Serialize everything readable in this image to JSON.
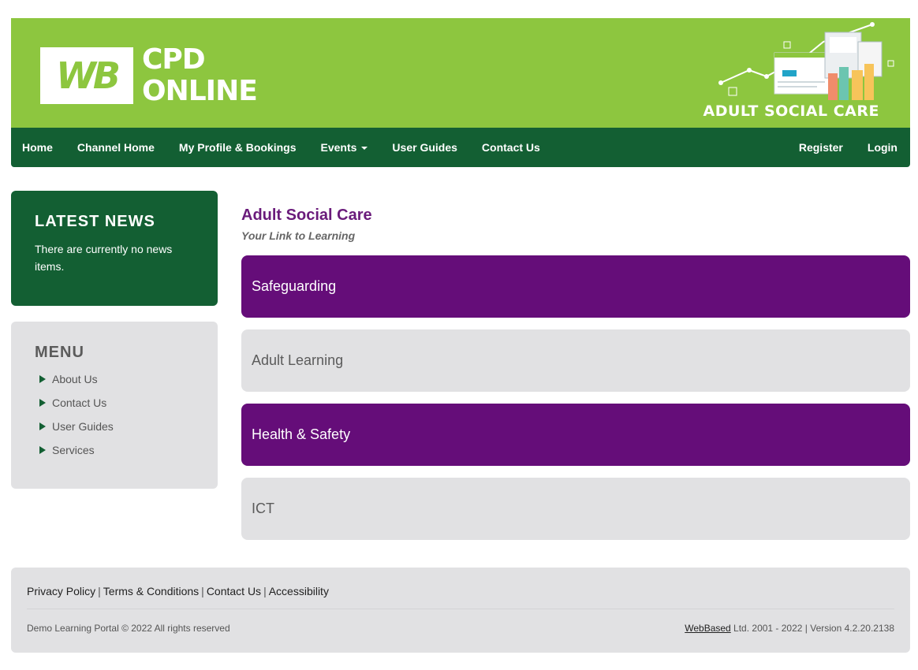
{
  "brand": {
    "logo_mark": "WB",
    "logo_line1": "CPD",
    "logo_line2": "ONLINE",
    "channel_caption": "ADULT SOCIAL CARE",
    "colors": {
      "green": "#8dc63f",
      "dark_green": "#135f33",
      "purple": "#650d79",
      "grey_panel": "#e1e1e3"
    }
  },
  "nav": {
    "left": [
      "Home",
      "Channel Home",
      "My Profile & Bookings",
      "Events",
      "User Guides",
      "Contact Us"
    ],
    "right": [
      "Register",
      "Login"
    ]
  },
  "news": {
    "title": "LATEST NEWS",
    "body": "There are currently no news items."
  },
  "menu": {
    "title": "MENU",
    "items": [
      "About Us",
      "Contact Us",
      "User Guides",
      "Services"
    ]
  },
  "main": {
    "title": "Adult Social Care",
    "subtitle": "Your Link to Learning",
    "channels": [
      "Safeguarding",
      "Adult Learning",
      "Health & Safety",
      "ICT"
    ]
  },
  "footer": {
    "links": [
      "Privacy Policy",
      "Terms & Conditions",
      "Contact Us",
      "Accessibility"
    ],
    "copyright": "Demo Learning Portal © 2022 All rights reserved",
    "company_link": "WebBased",
    "version_text": " Ltd. 2001 - 2022 | Version 4.2.20.2138"
  }
}
